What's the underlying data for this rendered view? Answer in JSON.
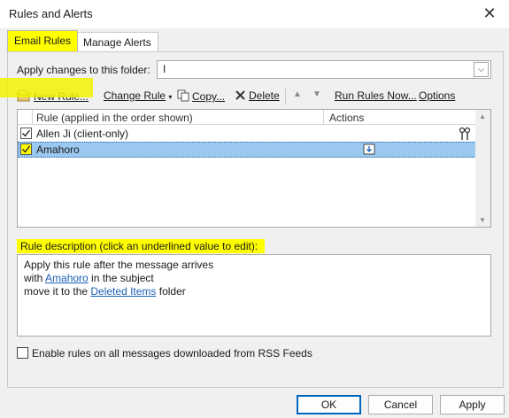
{
  "window": {
    "title": "Rules and Alerts",
    "close_glyph": "✕"
  },
  "tabs": [
    {
      "label": "Email Rules",
      "active": true
    },
    {
      "label": "Manage Alerts",
      "active": false
    }
  ],
  "folder": {
    "label": "Apply changes to this folder:",
    "value": "I",
    "dropdown_glyph": "⌵"
  },
  "toolbar": {
    "new_rule": "New Rule...",
    "change_rule": "Change Rule",
    "copy": "Copy...",
    "delete": "Delete",
    "up_glyph": "▲",
    "down_glyph": "▼",
    "run_rules": "Run Rules Now...",
    "options": "Options"
  },
  "rules": {
    "col_rule": "Rule (applied in the order shown)",
    "col_actions": "Actions",
    "items": [
      {
        "label": "Allen Ji  (client-only)",
        "checked": true,
        "selected": false
      },
      {
        "label": "Amahoro",
        "checked": true,
        "selected": true
      }
    ]
  },
  "description": {
    "label": "Rule description (click an underlined value to edit):",
    "line1": "Apply this rule after the message arrives",
    "line2_prefix": "with ",
    "line2_link": "Amahoro",
    "line2_suffix": " in the subject",
    "line3_prefix": "move it to the ",
    "line3_link": "Deleted Items",
    "line3_suffix": " folder"
  },
  "rss": {
    "label": "Enable rules on all messages downloaded from RSS Feeds",
    "checked": false
  },
  "buttons": {
    "ok": "OK",
    "cancel": "Cancel",
    "apply": "Apply"
  },
  "colors": {
    "highlight": "#ffff00",
    "selection": "#9bc8ee",
    "link": "#1a5fb4"
  }
}
